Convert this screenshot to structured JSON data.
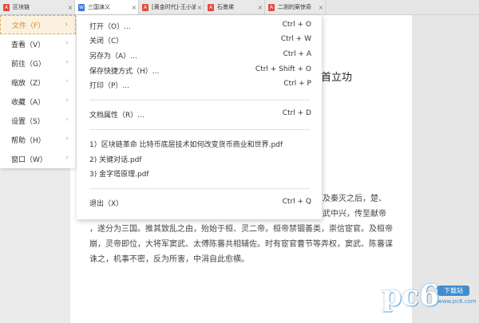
{
  "tabs": [
    {
      "label": "区块链",
      "icon": "pdf-file-icon",
      "active": false
    },
    {
      "label": "三国演义",
      "icon": "word-file-icon",
      "active": true
    },
    {
      "label": "[黄金时代]-王小波",
      "icon": "pdf-file-icon",
      "active": false
    },
    {
      "label": "石墨烯",
      "icon": "pdf-file-icon",
      "active": false
    },
    {
      "label": "二则的案惊奇",
      "icon": "pdf-file-icon",
      "active": false
    }
  ],
  "tab_close_glyph": "×",
  "menu": {
    "items": [
      {
        "label": "文件（F）",
        "active": true
      },
      {
        "label": "查看（V）",
        "active": false
      },
      {
        "label": "前往（G）",
        "active": false
      },
      {
        "label": "缩放（Z）",
        "active": false
      },
      {
        "label": "收藏（A）",
        "active": false
      },
      {
        "label": "设置（S）",
        "active": false
      },
      {
        "label": "帮助（H）",
        "active": false
      },
      {
        "label": "窗口（W）",
        "active": false
      }
    ],
    "chevron_glyph": "›"
  },
  "file_submenu": {
    "group1": [
      {
        "label": "打开（O）...",
        "shortcut": "Ctrl + O"
      },
      {
        "label": "关闭（C）",
        "shortcut": "Ctrl + W"
      },
      {
        "label": "另存为（A）...",
        "shortcut": "Ctrl + A"
      },
      {
        "label": "保存快捷方式（H）...",
        "shortcut": "Ctrl + Shift + O"
      },
      {
        "label": "打印（P）...",
        "shortcut": "Ctrl + P"
      }
    ],
    "group2": [
      {
        "label": "文档属性（R）...",
        "shortcut": "Ctrl + D"
      }
    ],
    "recent": [
      {
        "label": "1）区块链革命 比特币底层技术如何改变货币商业和世界.pdf"
      },
      {
        "label": "2) 关键对话.pdf"
      },
      {
        "label": "3) 金字塔原理.pdf"
      }
    ],
    "group4": [
      {
        "label": "退出（X）",
        "shortcut": "Ctrl + Q"
      }
    ]
  },
  "document": {
    "title_visible": "首立功",
    "lines": [
      "及秦灭之后，楚、",
      "武中兴，传至献帝",
      "，遂分为三国。推其致乱之由，殆始于桓、灵二帝。桓帝禁锢善类，崇信宦官。及桓帝",
      "崩，灵帝即位，大将军窦武、太傅陈蕃共相辅佐。时有宦官曹节等弄权，窦武、陈蕃谋",
      "诛之，机事不密，反为所害，中涓自此愈横。"
    ]
  },
  "watermark": {
    "logo_text": "pc6",
    "badge_text": "下载站",
    "sub_text": "www.pc6.com"
  }
}
